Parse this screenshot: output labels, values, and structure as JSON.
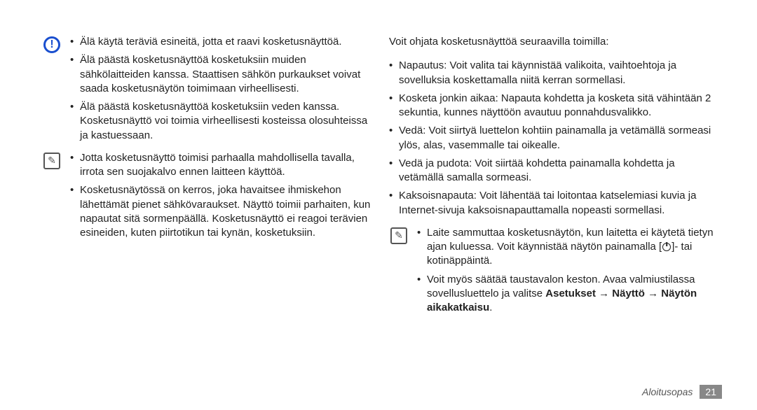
{
  "left_column": {
    "warning_bullets": [
      "Älä käytä teräviä esineitä, jotta et raavi kosketusnäyttöä.",
      "Älä päästä kosketusnäyttöä kosketuksiin muiden sähkölaitteiden kanssa. Staattisen sähkön purkaukset voivat saada kosketusnäytön toimimaan virheellisesti.",
      "Älä päästä kosketusnäyttöä kosketuksiin veden kanssa. Kosketusnäyttö voi toimia virheellisesti kosteissa olosuhteissa ja kastuessaan."
    ],
    "note_bullets": [
      "Jotta kosketusnäyttö toimisi parhaalla mahdollisella tavalla, irrota sen suojakalvo ennen laitteen käyttöä.",
      "Kosketusnäytössä on kerros, joka havaitsee ihmiskehon lähettämät pienet sähkövaraukset. Näyttö toimii parhaiten, kun napautat sitä sormenpäällä. Kosketusnäyttö ei reagoi terävien esineiden, kuten piirtotikun tai kynän, kosketuksiin."
    ]
  },
  "right_column": {
    "intro": "Voit ohjata kosketusnäyttöä seuraavilla toimilla:",
    "main_bullets": [
      "Napautus: Voit valita tai käynnistää valikoita, vaihtoehtoja ja sovelluksia koskettamalla niitä kerran sormellasi.",
      "Kosketa jonkin aikaa: Napauta kohdetta ja kosketa sitä vähintään 2 sekuntia, kunnes näyttöön avautuu ponnahdusvalikko.",
      "Vedä: Voit siirtyä luettelon kohtiin painamalla ja vetämällä sormeasi ylös, alas, vasemmalle tai oikealle.",
      "Vedä ja pudota: Voit siirtää kohdetta painamalla kohdetta ja vetämällä samalla sormeasi.",
      "Kaksoisnapauta: Voit lähentää tai loitontaa katselemiasi kuvia ja Internet-sivuja kaksoisnapauttamalla nopeasti sormellasi."
    ],
    "note_bullet_1_prefix": "Laite sammuttaa kosketusnäytön, kun laitetta ei käytetä tietyn ajan kuluessa. Voit käynnistää näytön painamalla [",
    "note_bullet_1_suffix": "]- tai kotinäppäintä.",
    "note_bullet_2_prefix": "Voit myös säätää taustavalon keston. Avaa valmiustilassa sovellusluettelo ja valitse ",
    "note_bullet_2_bold": "Asetukset → Näyttö → Näytön aikakatkaisu",
    "note_bullet_2_suffix": "."
  },
  "footer": {
    "label": "Aloitusopas",
    "page": "21"
  }
}
